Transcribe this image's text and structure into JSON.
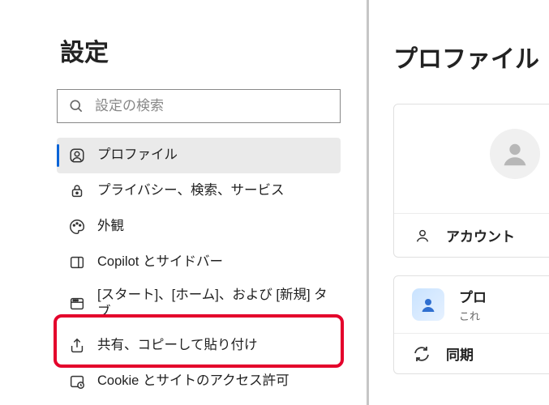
{
  "page_title": "設定",
  "search": {
    "placeholder": "設定の検索"
  },
  "sidebar": {
    "items": [
      {
        "label": "プロファイル",
        "icon": "profile-icon",
        "selected": true
      },
      {
        "label": "プライバシー、検索、サービス",
        "icon": "lock-icon",
        "selected": false
      },
      {
        "label": "外観",
        "icon": "palette-icon",
        "selected": false
      },
      {
        "label": "Copilot とサイドバー",
        "icon": "sidebar-icon",
        "selected": false
      },
      {
        "label": "[スタート]、[ホーム]、および [新規] タブ",
        "icon": "window-icon",
        "selected": false,
        "highlighted": true
      },
      {
        "label": "共有、コピーして貼り付け",
        "icon": "share-icon",
        "selected": false
      },
      {
        "label": "Cookie とサイトのアクセス許可",
        "icon": "cookie-icon",
        "selected": false
      }
    ]
  },
  "right": {
    "title": "プロファイル",
    "account_label": "アカウント",
    "card": {
      "row1": {
        "title": "プロ",
        "sub": "これ"
      },
      "row2": {
        "title": "同期"
      }
    }
  }
}
